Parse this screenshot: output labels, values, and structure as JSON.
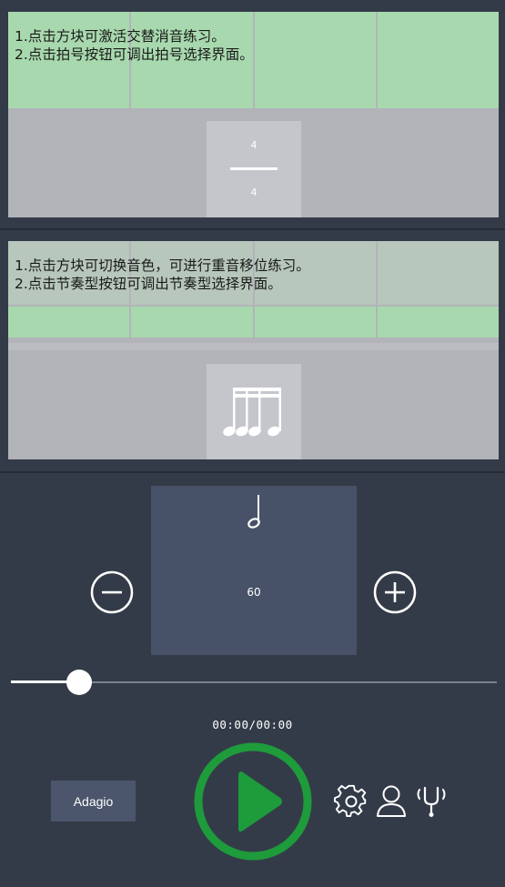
{
  "panel_beat": {
    "hint_line1": "1.点击方块可激活交替消音练习。",
    "hint_line2": "2.点击拍号按钮可调出拍号选择界面。",
    "time_signature": {
      "numerator": "4",
      "denominator": "4"
    }
  },
  "panel_rhythm": {
    "hint_line1": "1.点击方块可切换音色，可进行重音移位练习。",
    "hint_line2": "2.点击节奏型按钮可调出节奏型选择界面。",
    "rhythm_icon": "sixteenth-notes-icon"
  },
  "tempo": {
    "note_icon": "half-note-icon",
    "bpm": "60",
    "minus_icon": "minus-circle-icon",
    "plus_icon": "plus-circle-icon",
    "name": "Adagio"
  },
  "slider": {
    "value_fraction": 0.14
  },
  "playback": {
    "time": "00:00/00:00",
    "play_icon": "play-icon"
  },
  "toolbar": {
    "icons": [
      "gear-icon",
      "user-icon",
      "tuning-fork-icon"
    ]
  },
  "colors": {
    "background": "#343b48",
    "panel": "#b2b4ba",
    "active_cell": "#a8d9ae",
    "tempo_box": "#475269",
    "play_accent": "#1e9b3b"
  }
}
